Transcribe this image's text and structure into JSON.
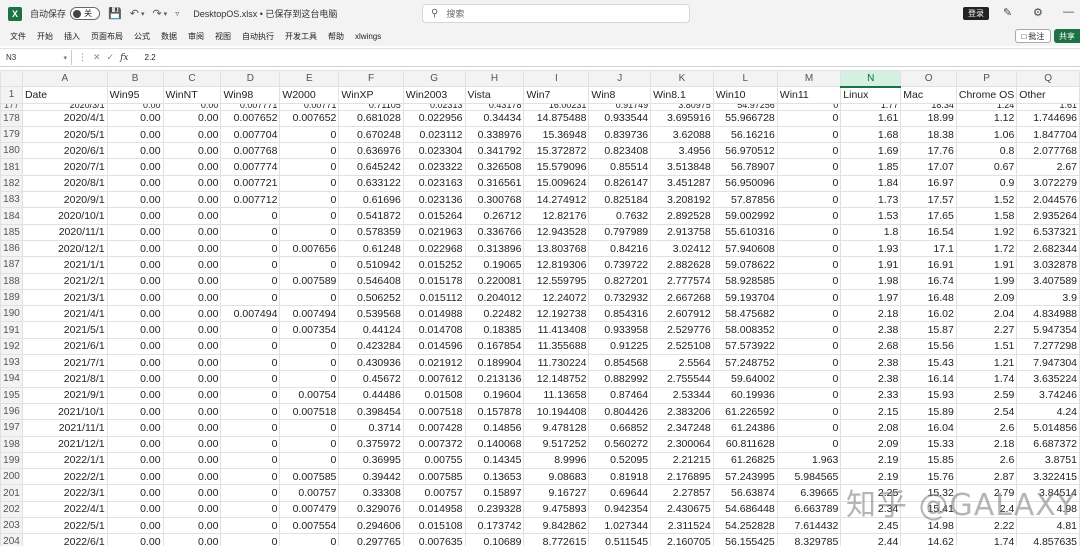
{
  "titlebar": {
    "app_logo": "X",
    "autosave_label": "自动保存",
    "autosave_state": "关",
    "icons": [
      "excel-logo-icon",
      "save-icon",
      "undo-icon",
      "redo-icon",
      "customize-qat-icon"
    ],
    "doc_title": "DesktopOS.xlsx • 已保存到这台电脑",
    "search_placeholder": "搜索",
    "login_label": "登录",
    "minimize_label": "—"
  },
  "ribbon": {
    "tabs": [
      "文件",
      "开始",
      "插入",
      "页面布局",
      "公式",
      "数据",
      "审阅",
      "视图",
      "自动执行",
      "开发工具",
      "帮助",
      "xlwings"
    ],
    "comment_label": "批注",
    "share_label": "共享"
  },
  "formula_bar": {
    "name_box": "N3",
    "formula": "2.2"
  },
  "grid": {
    "selected_column": "N",
    "columns": [
      "A",
      "B",
      "C",
      "D",
      "E",
      "F",
      "G",
      "H",
      "I",
      "J",
      "K",
      "L",
      "M",
      "N",
      "O",
      "P",
      "Q"
    ],
    "header_row_number": "1",
    "headers": [
      "Date",
      "Win95",
      "WinNT",
      "Win98",
      "W2000",
      "WinXP",
      "Win2003",
      "Vista",
      "Win7",
      "Win8",
      "Win8.1",
      "Win10",
      "Win11",
      "Linux",
      "Mac",
      "Chrome OS",
      "Other"
    ],
    "partial_row": {
      "num": "177",
      "cells": [
        "2020/3/1",
        "0.00",
        "0.00",
        "0.007771",
        "0.00771",
        "0.71105",
        "0.02313",
        "0.43178",
        "16.00231",
        "0.91749",
        "3.80975",
        "54.97256",
        "0",
        "1.77",
        "18.34",
        "1.24",
        "1.61"
      ]
    },
    "rows": [
      {
        "num": "178",
        "cells": [
          "2020/4/1",
          "0.00",
          "0.00",
          "0.007652",
          "0.007652",
          "0.681028",
          "0.022956",
          "0.34434",
          "14.875488",
          "0.933544",
          "3.695916",
          "55.966728",
          "0",
          "1.61",
          "18.99",
          "1.12",
          "1.744696"
        ]
      },
      {
        "num": "179",
        "cells": [
          "2020/5/1",
          "0.00",
          "0.00",
          "0.007704",
          "0",
          "0.670248",
          "0.023112",
          "0.338976",
          "15.36948",
          "0.839736",
          "3.62088",
          "56.16216",
          "0",
          "1.68",
          "18.38",
          "1.06",
          "1.847704"
        ]
      },
      {
        "num": "180",
        "cells": [
          "2020/6/1",
          "0.00",
          "0.00",
          "0.007768",
          "0",
          "0.636976",
          "0.023304",
          "0.341792",
          "15.372872",
          "0.823408",
          "3.4956",
          "56.970512",
          "0",
          "1.69",
          "17.76",
          "0.8",
          "2.077768"
        ]
      },
      {
        "num": "181",
        "cells": [
          "2020/7/1",
          "0.00",
          "0.00",
          "0.007774",
          "0",
          "0.645242",
          "0.023322",
          "0.326508",
          "15.579096",
          "0.85514",
          "3.513848",
          "56.78907",
          "0",
          "1.85",
          "17.07",
          "0.67",
          "2.67"
        ]
      },
      {
        "num": "182",
        "cells": [
          "2020/8/1",
          "0.00",
          "0.00",
          "0.007721",
          "0",
          "0.633122",
          "0.023163",
          "0.316561",
          "15.009624",
          "0.826147",
          "3.451287",
          "56.950096",
          "0",
          "1.84",
          "16.97",
          "0.9",
          "3.072279"
        ]
      },
      {
        "num": "183",
        "cells": [
          "2020/9/1",
          "0.00",
          "0.00",
          "0.007712",
          "0",
          "0.61696",
          "0.023136",
          "0.300768",
          "14.274912",
          "0.825184",
          "3.208192",
          "57.87856",
          "0",
          "1.73",
          "17.57",
          "1.52",
          "2.044576"
        ]
      },
      {
        "num": "184",
        "cells": [
          "2020/10/1",
          "0.00",
          "0.00",
          "0",
          "0",
          "0.541872",
          "0.015264",
          "0.26712",
          "12.82176",
          "0.7632",
          "2.892528",
          "59.002992",
          "0",
          "1.53",
          "17.65",
          "1.58",
          "2.935264"
        ]
      },
      {
        "num": "185",
        "cells": [
          "2020/11/1",
          "0.00",
          "0.00",
          "0",
          "0",
          "0.578359",
          "0.021963",
          "0.336766",
          "12.943528",
          "0.797989",
          "2.913758",
          "55.610316",
          "0",
          "1.8",
          "16.54",
          "1.92",
          "6.537321"
        ]
      },
      {
        "num": "186",
        "cells": [
          "2020/12/1",
          "0.00",
          "0.00",
          "0",
          "0.007656",
          "0.61248",
          "0.022968",
          "0.313896",
          "13.803768",
          "0.84216",
          "3.02412",
          "57.940608",
          "0",
          "1.93",
          "17.1",
          "1.72",
          "2.682344"
        ]
      },
      {
        "num": "187",
        "cells": [
          "2021/1/1",
          "0.00",
          "0.00",
          "0",
          "0",
          "0.510942",
          "0.015252",
          "0.19065",
          "12.819306",
          "0.739722",
          "2.882628",
          "59.078622",
          "0",
          "1.91",
          "16.91",
          "1.91",
          "3.032878"
        ]
      },
      {
        "num": "188",
        "cells": [
          "2021/2/1",
          "0.00",
          "0.00",
          "0",
          "0.007589",
          "0.546408",
          "0.015178",
          "0.220081",
          "12.559795",
          "0.827201",
          "2.777574",
          "58.928585",
          "0",
          "1.98",
          "16.74",
          "1.99",
          "3.407589"
        ]
      },
      {
        "num": "189",
        "cells": [
          "2021/3/1",
          "0.00",
          "0.00",
          "0",
          "0",
          "0.506252",
          "0.015112",
          "0.204012",
          "12.24072",
          "0.732932",
          "2.667268",
          "59.193704",
          "0",
          "1.97",
          "16.48",
          "2.09",
          "3.9"
        ]
      },
      {
        "num": "190",
        "cells": [
          "2021/4/1",
          "0.00",
          "0.00",
          "0.007494",
          "0.007494",
          "0.539568",
          "0.014988",
          "0.22482",
          "12.192738",
          "0.854316",
          "2.607912",
          "58.475682",
          "0",
          "2.18",
          "16.02",
          "2.04",
          "4.834988"
        ]
      },
      {
        "num": "191",
        "cells": [
          "2021/5/1",
          "0.00",
          "0.00",
          "0",
          "0.007354",
          "0.44124",
          "0.014708",
          "0.18385",
          "11.413408",
          "0.933958",
          "2.529776",
          "58.008352",
          "0",
          "2.38",
          "15.87",
          "2.27",
          "5.947354"
        ]
      },
      {
        "num": "192",
        "cells": [
          "2021/6/1",
          "0.00",
          "0.00",
          "0",
          "0",
          "0.423284",
          "0.014596",
          "0.167854",
          "11.355688",
          "0.91225",
          "2.525108",
          "57.573922",
          "0",
          "2.68",
          "15.56",
          "1.51",
          "7.277298"
        ]
      },
      {
        "num": "193",
        "cells": [
          "2021/7/1",
          "0.00",
          "0.00",
          "0",
          "0",
          "0.430936",
          "0.021912",
          "0.189904",
          "11.730224",
          "0.854568",
          "2.5564",
          "57.248752",
          "0",
          "2.38",
          "15.43",
          "1.21",
          "7.947304"
        ]
      },
      {
        "num": "194",
        "cells": [
          "2021/8/1",
          "0.00",
          "0.00",
          "0",
          "0",
          "0.45672",
          "0.007612",
          "0.213136",
          "12.148752",
          "0.882992",
          "2.755544",
          "59.64002",
          "0",
          "2.38",
          "16.14",
          "1.74",
          "3.635224"
        ]
      },
      {
        "num": "195",
        "cells": [
          "2021/9/1",
          "0.00",
          "0.00",
          "0",
          "0.00754",
          "0.44486",
          "0.01508",
          "0.19604",
          "11.13658",
          "0.87464",
          "2.53344",
          "60.19936",
          "0",
          "2.33",
          "15.93",
          "2.59",
          "3.74246"
        ]
      },
      {
        "num": "196",
        "cells": [
          "2021/10/1",
          "0.00",
          "0.00",
          "0",
          "0.007518",
          "0.398454",
          "0.007518",
          "0.157878",
          "10.194408",
          "0.804426",
          "2.383206",
          "61.226592",
          "0",
          "2.15",
          "15.89",
          "2.54",
          "4.24"
        ]
      },
      {
        "num": "197",
        "cells": [
          "2021/11/1",
          "0.00",
          "0.00",
          "0",
          "0",
          "0.3714",
          "0.007428",
          "0.14856",
          "9.478128",
          "0.66852",
          "2.347248",
          "61.24386",
          "0",
          "2.08",
          "16.04",
          "2.6",
          "5.014856"
        ]
      },
      {
        "num": "198",
        "cells": [
          "2021/12/1",
          "0.00",
          "0.00",
          "0",
          "0",
          "0.375972",
          "0.007372",
          "0.140068",
          "9.517252",
          "0.560272",
          "2.300064",
          "60.811628",
          "0",
          "2.09",
          "15.33",
          "2.18",
          "6.687372"
        ]
      },
      {
        "num": "199",
        "cells": [
          "2022/1/1",
          "0.00",
          "0.00",
          "0",
          "0",
          "0.36995",
          "0.00755",
          "0.14345",
          "8.9996",
          "0.52095",
          "2.21215",
          "61.26825",
          "1.963",
          "2.19",
          "15.85",
          "2.6",
          "3.8751"
        ]
      },
      {
        "num": "200",
        "cells": [
          "2022/2/1",
          "0.00",
          "0.00",
          "0",
          "0.007585",
          "0.39442",
          "0.007585",
          "0.13653",
          "9.08683",
          "0.81918",
          "2.176895",
          "57.243995",
          "5.984565",
          "2.19",
          "15.76",
          "2.87",
          "3.322415"
        ]
      },
      {
        "num": "201",
        "cells": [
          "2022/3/1",
          "0.00",
          "0.00",
          "0",
          "0.00757",
          "0.33308",
          "0.00757",
          "0.15897",
          "9.16727",
          "0.69644",
          "2.27857",
          "56.63874",
          "6.39665",
          "2.25",
          "15.32",
          "2.79",
          "3.84514"
        ]
      },
      {
        "num": "202",
        "cells": [
          "2022/4/1",
          "0.00",
          "0.00",
          "0",
          "0.007479",
          "0.329076",
          "0.014958",
          "0.239328",
          "9.475893",
          "0.942354",
          "2.430675",
          "54.686448",
          "6.663789",
          "2.34",
          "15.41",
          "2.4",
          "4.98"
        ]
      },
      {
        "num": "203",
        "cells": [
          "2022/5/1",
          "0.00",
          "0.00",
          "0",
          "0.007554",
          "0.294606",
          "0.015108",
          "0.173742",
          "9.842862",
          "1.027344",
          "2.311524",
          "54.252828",
          "7.614432",
          "2.45",
          "14.98",
          "2.22",
          "4.81"
        ]
      },
      {
        "num": "204",
        "cells": [
          "2022/6/1",
          "0.00",
          "0.00",
          "0",
          "0",
          "0.297765",
          "0.007635",
          "0.10689",
          "8.772615",
          "0.511545",
          "2.160705",
          "56.155425",
          "8.329785",
          "2.44",
          "14.62",
          "1.74",
          "4.857635"
        ]
      }
    ]
  },
  "watermark": "知乎 @GALAXY"
}
